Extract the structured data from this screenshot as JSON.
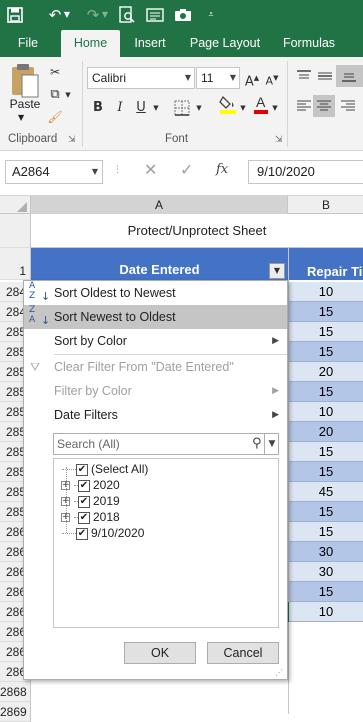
{
  "colors": {
    "excel_green": "#217346",
    "header_fill": "#4472c4",
    "row_fill_light": "#dce6f2",
    "row_fill_mid": "#b4c6e7"
  },
  "qat": {
    "icons": [
      "save-icon",
      "undo-icon",
      "redo-icon",
      "print-preview-icon",
      "form-icon",
      "camera-icon",
      "customize-icon"
    ]
  },
  "tabs": [
    "File",
    "Home",
    "Insert",
    "Page Layout",
    "Formulas"
  ],
  "ribbon": {
    "paste_label": "Paste",
    "clipboard_label": "Clipboard",
    "font_label": "Font",
    "font_name": "Calibri",
    "font_size": "11",
    "bold": "B",
    "italic": "I",
    "underline": "U",
    "grow": "A",
    "shrink": "A"
  },
  "formula_bar": {
    "name_box": "A2864",
    "fx": "fx",
    "value": "9/10/2020"
  },
  "columns": [
    "A",
    "B"
  ],
  "sheet": {
    "merged_title": "Protect/Unprotect Sheet",
    "header_row_num": "1",
    "header_a": "Date Entered",
    "header_b": "Repair Tim"
  },
  "rows": [
    {
      "num": "284",
      "b": "10"
    },
    {
      "num": "284",
      "b": "15"
    },
    {
      "num": "285",
      "b": "15"
    },
    {
      "num": "285",
      "b": "15"
    },
    {
      "num": "285",
      "b": "20"
    },
    {
      "num": "285",
      "b": "15"
    },
    {
      "num": "285",
      "b": "10"
    },
    {
      "num": "285",
      "b": "20"
    },
    {
      "num": "285",
      "b": "15"
    },
    {
      "num": "285",
      "b": "15"
    },
    {
      "num": "285",
      "b": "45"
    },
    {
      "num": "285",
      "b": "15"
    },
    {
      "num": "286",
      "b": "15"
    },
    {
      "num": "286",
      "b": "30"
    },
    {
      "num": "286",
      "b": "30"
    },
    {
      "num": "286",
      "b": "15"
    },
    {
      "num": "286",
      "b": "10"
    },
    {
      "num": "286",
      "b": ""
    },
    {
      "num": "286",
      "b": ""
    },
    {
      "num": "286",
      "b": ""
    },
    {
      "num": "2868",
      "b": ""
    },
    {
      "num": "2869",
      "b": ""
    }
  ],
  "filter_menu": {
    "sort_oldest": "Sort Oldest to Newest",
    "sort_newest": "Sort Newest to Oldest",
    "sort_by_color": "Sort by Color",
    "clear_filter": "Clear Filter From \"Date Entered\"",
    "filter_by_color": "Filter by Color",
    "date_filters": "Date Filters",
    "search_placeholder": "Search (All)",
    "tree": [
      {
        "label": "(Select All)",
        "expandable": false
      },
      {
        "label": "2020",
        "expandable": true
      },
      {
        "label": "2019",
        "expandable": true
      },
      {
        "label": "2018",
        "expandable": true
      },
      {
        "label": "9/10/2020",
        "expandable": false
      }
    ],
    "ok": "OK",
    "cancel": "Cancel"
  }
}
